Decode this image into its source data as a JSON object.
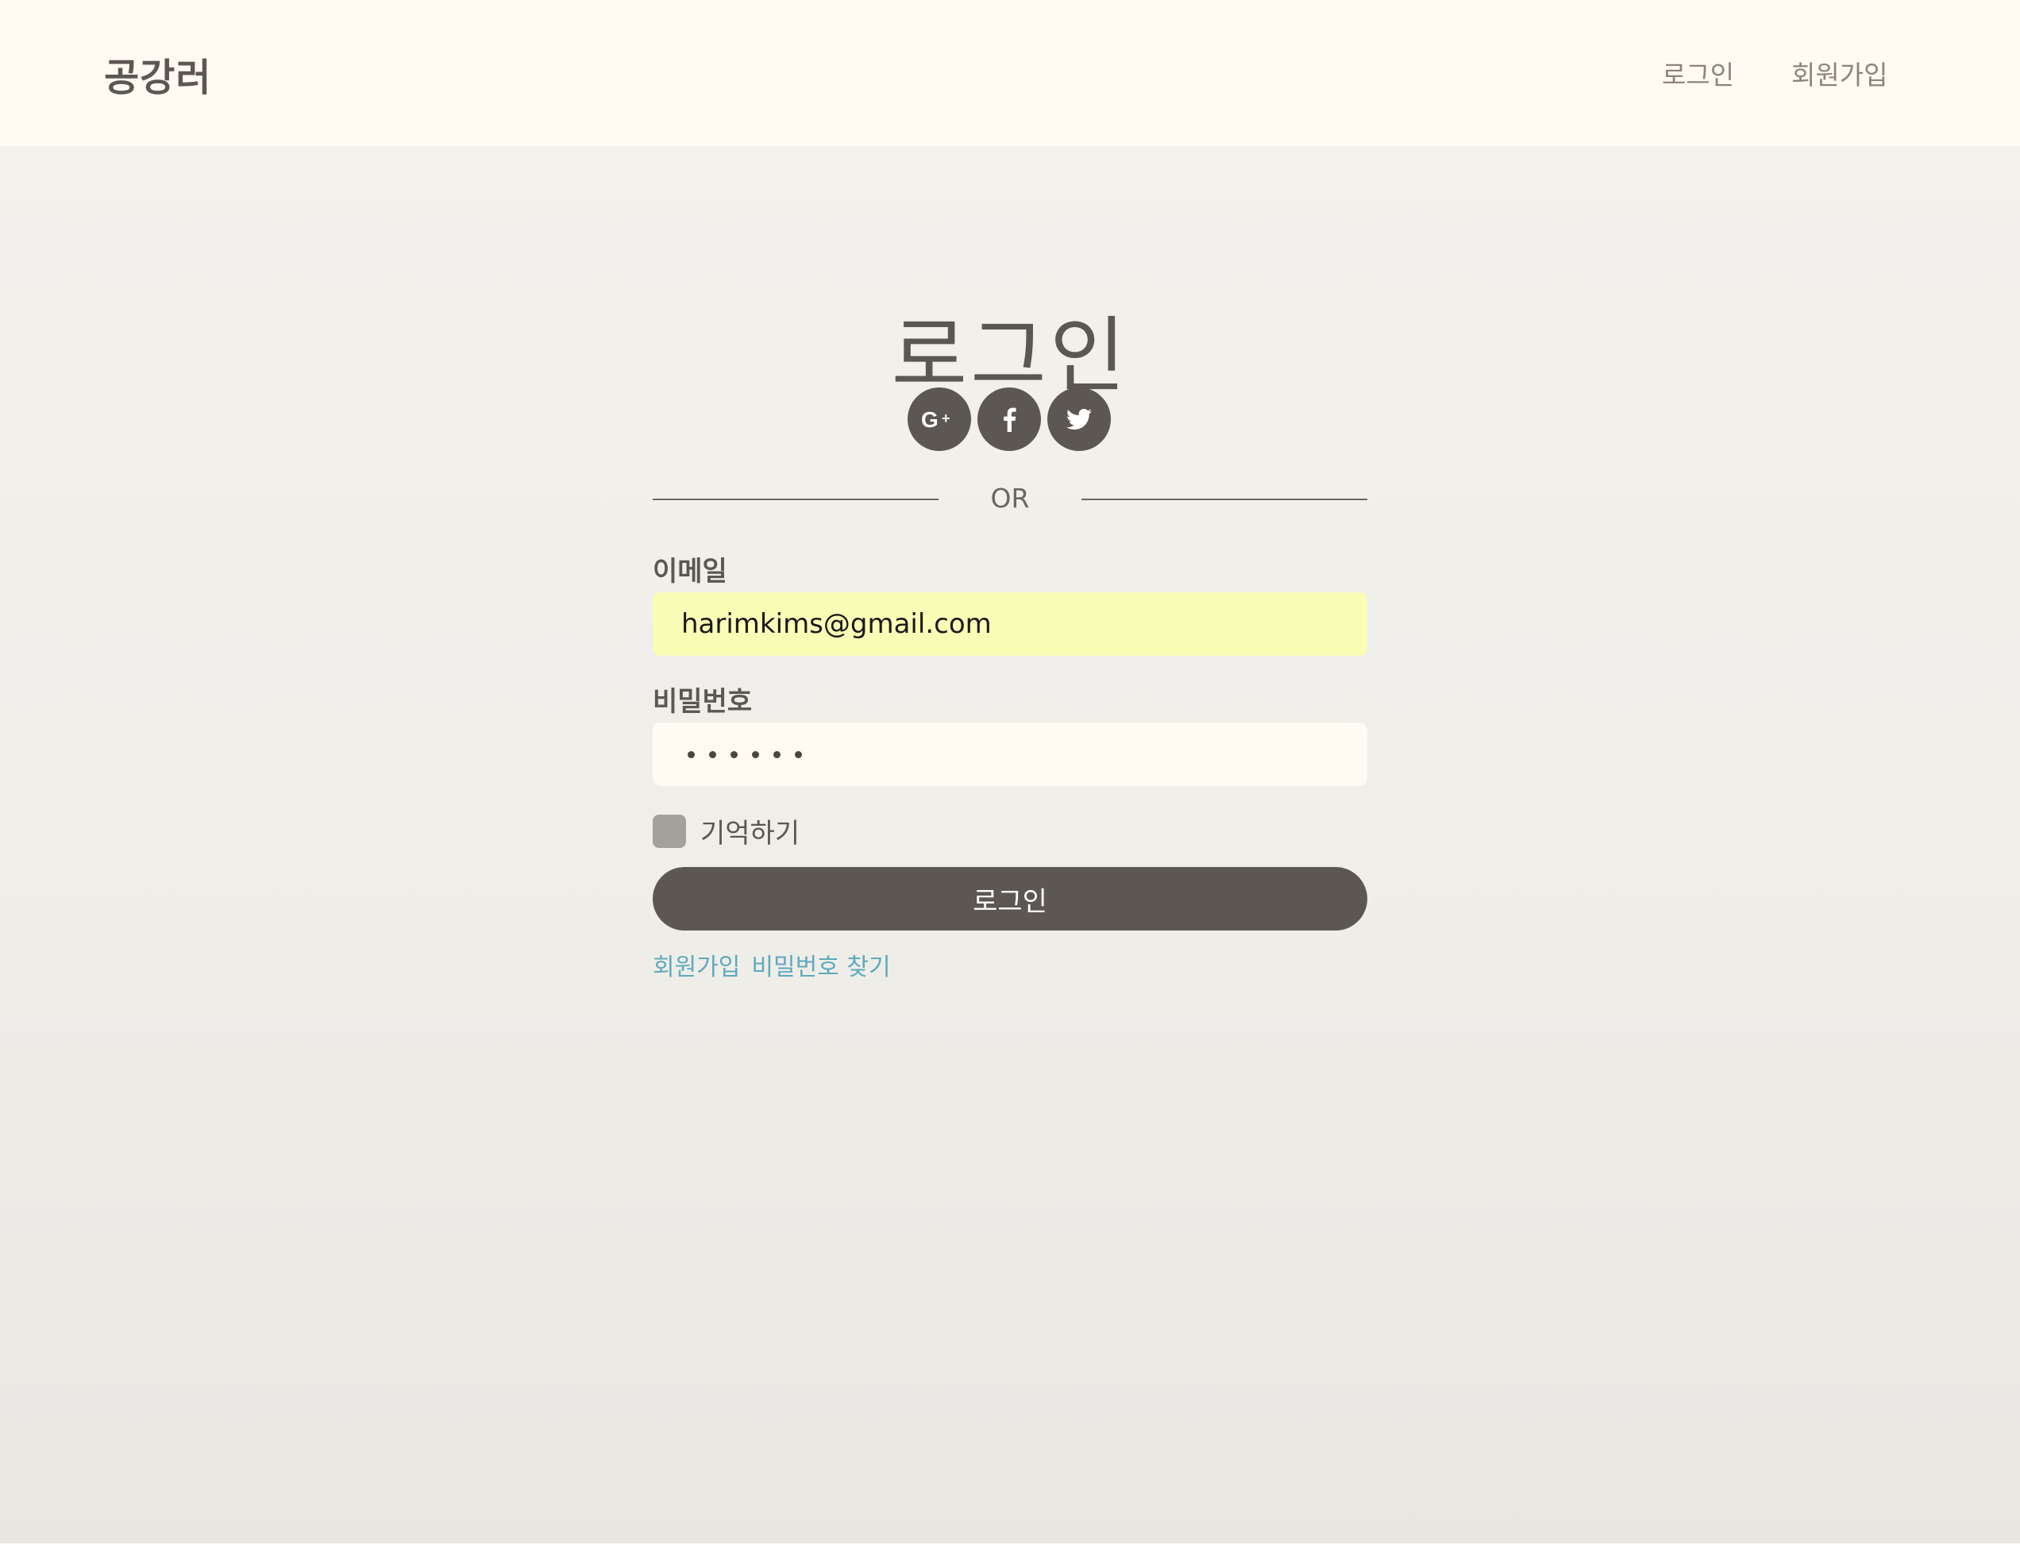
{
  "header": {
    "brand": "공강러",
    "nav": {
      "login": "로그인",
      "signup": "회원가입"
    }
  },
  "main": {
    "title": "로그인",
    "social": [
      {
        "name": "google-plus-icon",
        "label": "G+"
      },
      {
        "name": "facebook-icon",
        "label": "f"
      },
      {
        "name": "twitter-icon",
        "label": ""
      }
    ],
    "divider_text": "OR",
    "email": {
      "label": "이메일",
      "value": "harimkims@gmail.com"
    },
    "password": {
      "label": "비밀번호",
      "masked_length": 6
    },
    "remember": {
      "label": "기억하기",
      "checked": false
    },
    "login_button": "로그인",
    "links": {
      "signup": "회원가입",
      "find_password": "비밀번호 찾기"
    }
  },
  "colors": {
    "header_bg": "#fffaf2",
    "text_primary": "#5c5752",
    "button_bg": "#5c5752",
    "email_autofill_bg": "#fafdb6",
    "link": "#5fa9bf"
  }
}
